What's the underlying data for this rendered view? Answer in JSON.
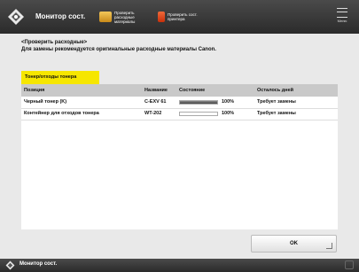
{
  "header": {
    "title": "Монитор сост.",
    "btn1_label": "Проверить расходные материалы",
    "btn2_label": "Проверить сост. принтера",
    "menu_label": "Меню"
  },
  "message": {
    "line1": "<Проверить расходные>",
    "line2": "Для замены рекомендуется оригинальные расходные материалы Canon."
  },
  "tab": {
    "label": "Тонер/отходы тонера"
  },
  "table": {
    "headers": [
      "Позиция",
      "Название",
      "Состояние",
      "Осталось дней"
    ],
    "rows": [
      {
        "item": "Черный тонер (K)",
        "name": "C-EXV 61",
        "level": 100,
        "level_text": "100%",
        "days": "Требует замены"
      },
      {
        "item": "Контейнер для отходов тонера",
        "name": "WT-202",
        "level": 0,
        "level_text": "100%",
        "days": "Требует замены"
      }
    ]
  },
  "ok_button": {
    "label": "OK"
  },
  "footer": {
    "label": "Монитор сост."
  },
  "colors": {
    "tab_yellow": "#f6e600",
    "topbar": "#333333"
  }
}
